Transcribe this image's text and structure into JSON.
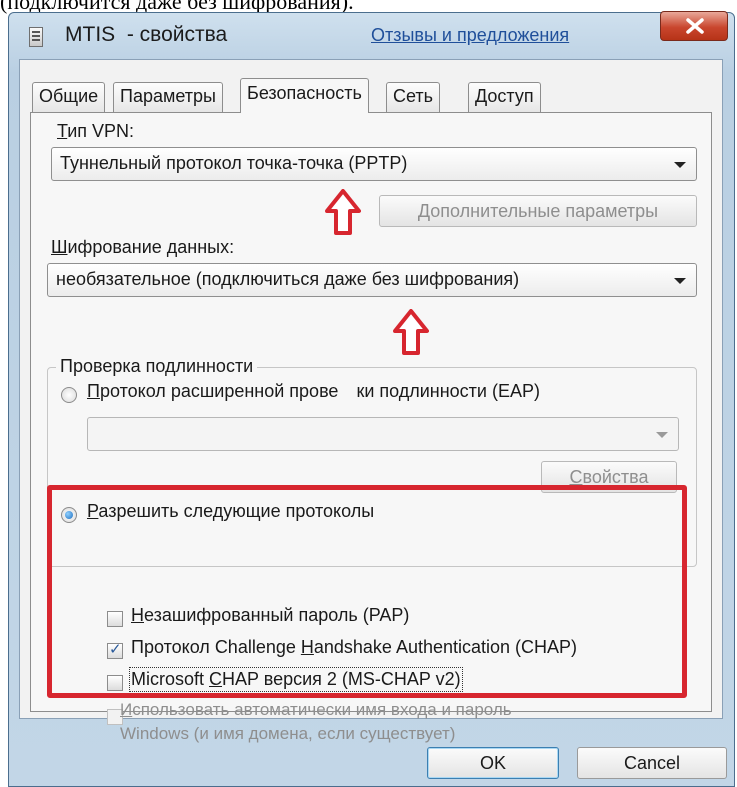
{
  "top_caption": "(подключится даже без шифрования).",
  "window": {
    "title": "MTIS  - свойства",
    "feedback_link": "Отзывы и предложения"
  },
  "tabs": [
    {
      "label": "Общие"
    },
    {
      "label": "Параметры"
    },
    {
      "label": "Безопасность"
    },
    {
      "label": "Сеть"
    },
    {
      "label": "Доступ"
    }
  ],
  "vpn": {
    "type_label_accel": "Т",
    "type_label_rest": "ип VPN:",
    "type_value": "Туннельный протокол точка-точка (PPTP)",
    "advanced_button": "Дополнительные параметры"
  },
  "encryption": {
    "label_accel": "Ш",
    "label_rest": "ифрование данных:",
    "value": "необязательное (подключиться даже без шифрования)"
  },
  "auth": {
    "group_title": "Проверка подлинности",
    "eap_accel": "П",
    "eap_rest": "ротокол расширенной прове",
    "eap_rest2": "ки подлинности (EAP)",
    "eap_combo_value": "",
    "properties_button_accel": "С",
    "properties_button_rest": "войства",
    "allow_accel": "Р",
    "allow_rest": "азрешить следующие протоколы"
  },
  "protocols": [
    {
      "pre": "",
      "accel": "Н",
      "post": "езашифрованный пароль (PAP)",
      "checked": false,
      "disabled": false
    },
    {
      "pre": "Протокол Challenge ",
      "accel": "H",
      "post": "andshake Authentication (CHAP)",
      "checked": true,
      "disabled": false
    },
    {
      "pre": "Microsoft ",
      "accel": "C",
      "post": "HAP версия 2 (MS-CHAP v2)",
      "checked": false,
      "disabled": false
    },
    {
      "pre": "",
      "accel": "И",
      "post": "спользовать автоматически имя входа и пароль",
      "checked": false,
      "disabled": true
    }
  ],
  "windows_note": "Windows (и имя домена, если существует)",
  "buttons": {
    "ok": "OK",
    "cancel": "Cancel"
  },
  "colors": {
    "annotation_red": "#d7262f",
    "link_blue": "#1f4f9a"
  }
}
